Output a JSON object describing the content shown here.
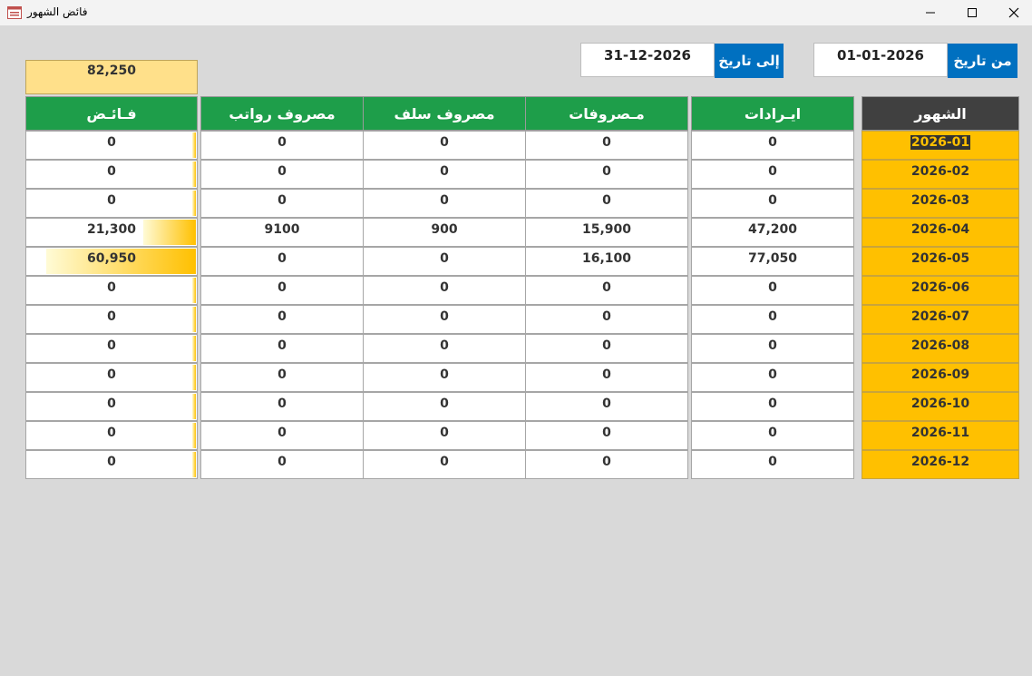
{
  "window": {
    "title": "فائض الشهور"
  },
  "filters": {
    "from_label": "من تاريخ",
    "from_value": "01-01-2026",
    "to_label": "إلى تاريخ",
    "to_value": "31-12-2026"
  },
  "total_surplus": "82,250",
  "columns": {
    "month": "الشهور",
    "revenue": "ايـرادات",
    "expenses": "مـصروفات",
    "advances": "مصروف سلف",
    "salaries": "مصروف رواتب",
    "surplus": "فـائـض"
  },
  "rows": [
    {
      "month": "2026-01",
      "revenue": "0",
      "expenses": "0",
      "advances": "0",
      "salaries": "0",
      "surplus": "0",
      "surplus_value": 0
    },
    {
      "month": "2026-02",
      "revenue": "0",
      "expenses": "0",
      "advances": "0",
      "salaries": "0",
      "surplus": "0",
      "surplus_value": 0
    },
    {
      "month": "2026-03",
      "revenue": "0",
      "expenses": "0",
      "advances": "0",
      "salaries": "0",
      "surplus": "0",
      "surplus_value": 0
    },
    {
      "month": "2026-04",
      "revenue": "47,200",
      "expenses": "15,900",
      "advances": "900",
      "salaries": "9100",
      "surplus": "21,300",
      "surplus_value": 21300
    },
    {
      "month": "2026-05",
      "revenue": "77,050",
      "expenses": "16,100",
      "advances": "0",
      "salaries": "0",
      "surplus": "60,950",
      "surplus_value": 60950
    },
    {
      "month": "2026-06",
      "revenue": "0",
      "expenses": "0",
      "advances": "0",
      "salaries": "0",
      "surplus": "0",
      "surplus_value": 0
    },
    {
      "month": "2026-07",
      "revenue": "0",
      "expenses": "0",
      "advances": "0",
      "salaries": "0",
      "surplus": "0",
      "surplus_value": 0
    },
    {
      "month": "2026-08",
      "revenue": "0",
      "expenses": "0",
      "advances": "0",
      "salaries": "0",
      "surplus": "0",
      "surplus_value": 0
    },
    {
      "month": "2026-09",
      "revenue": "0",
      "expenses": "0",
      "advances": "0",
      "salaries": "0",
      "surplus": "0",
      "surplus_value": 0
    },
    {
      "month": "2026-10",
      "revenue": "0",
      "expenses": "0",
      "advances": "0",
      "salaries": "0",
      "surplus": "0",
      "surplus_value": 0
    },
    {
      "month": "2026-11",
      "revenue": "0",
      "expenses": "0",
      "advances": "0",
      "salaries": "0",
      "surplus": "0",
      "surplus_value": 0
    },
    {
      "month": "2026-12",
      "revenue": "0",
      "expenses": "0",
      "advances": "0",
      "salaries": "0",
      "surplus": "0",
      "surplus_value": 0
    }
  ],
  "colors": {
    "header_green": "#1e9e4a",
    "header_dark": "#404040",
    "month_fill": "#ffc000",
    "date_label_blue": "#0070c0",
    "total_fill": "#ffe08a"
  }
}
